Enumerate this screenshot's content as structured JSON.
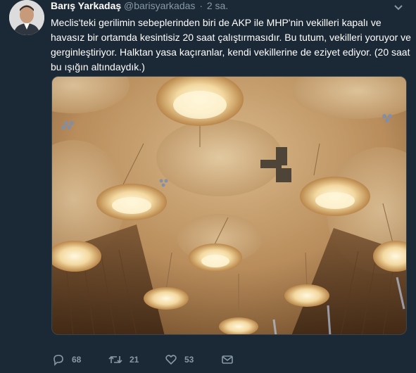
{
  "tweet": {
    "author_name": "Barış Yarkadaş",
    "author_handle": "@barisyarkadas",
    "separator": "·",
    "time": "2 sa.",
    "text_lines": [
      "Meclis'teki gerilimin sebeplerinden biri de AKP ile MHP'nin vekilleri kapalı ve",
      "havasız bir ortamda kesintisiz 20 saat çalıştırmasıdır. Bu tutum, vekilleri yoruyor ve",
      "gerginleştiriyor. Halktan yasa kaçıranlar, kendi vekillerine de eziyet ediyor. (20 saat",
      "bu ışığın altındaydık.)"
    ]
  },
  "actions": {
    "reply_count": "68",
    "retweet_count": "21",
    "like_count": "53",
    "reply_icon": "reply-icon",
    "retweet_icon": "retweet-icon",
    "like_icon": "heart-icon",
    "dm_icon": "envelope-icon"
  },
  "colors": {
    "background": "#1b2836",
    "text": "#ffffff",
    "muted": "#8899a6"
  }
}
